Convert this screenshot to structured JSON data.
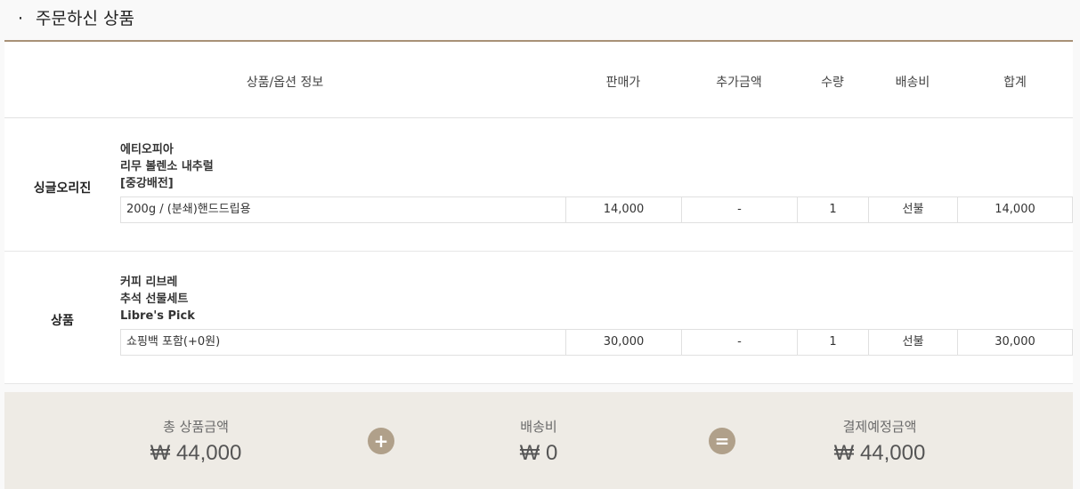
{
  "section": {
    "bullet": "·",
    "title": "주문하신 상품"
  },
  "table": {
    "headers": {
      "product": "상품/옵션 정보",
      "price": "판매가",
      "extra": "추가금액",
      "qty": "수량",
      "shipping": "배송비",
      "total": "합계"
    },
    "groups": [
      {
        "category": "싱글오리진",
        "name_lines": [
          "에티오피아",
          "리무 볼렌소 내추럴",
          "[중강배전]"
        ],
        "option": "200g / (분쇄)핸드드립용",
        "price": "14,000",
        "extra": "-",
        "qty": "1",
        "shipping": "선불",
        "total": "14,000"
      },
      {
        "category": "상품",
        "name_lines": [
          "커피 리브레",
          "추석 선물세트",
          "Libre's Pick"
        ],
        "option": "쇼핑백 포함(+0원)",
        "price": "30,000",
        "extra": "-",
        "qty": "1",
        "shipping": "선불",
        "total": "30,000"
      }
    ]
  },
  "summary": {
    "subtotal_label": "총 상품금액",
    "subtotal_value": "₩ 44,000",
    "plus": "+",
    "shipping_label": "배송비",
    "shipping_value": "₩ 0",
    "equals": "=",
    "total_label": "결제예정금액",
    "total_value": "₩ 44,000"
  },
  "colors": {
    "accent": "#a89177",
    "summary_bg": "#eeebe5",
    "operator": "#b0a08a"
  }
}
